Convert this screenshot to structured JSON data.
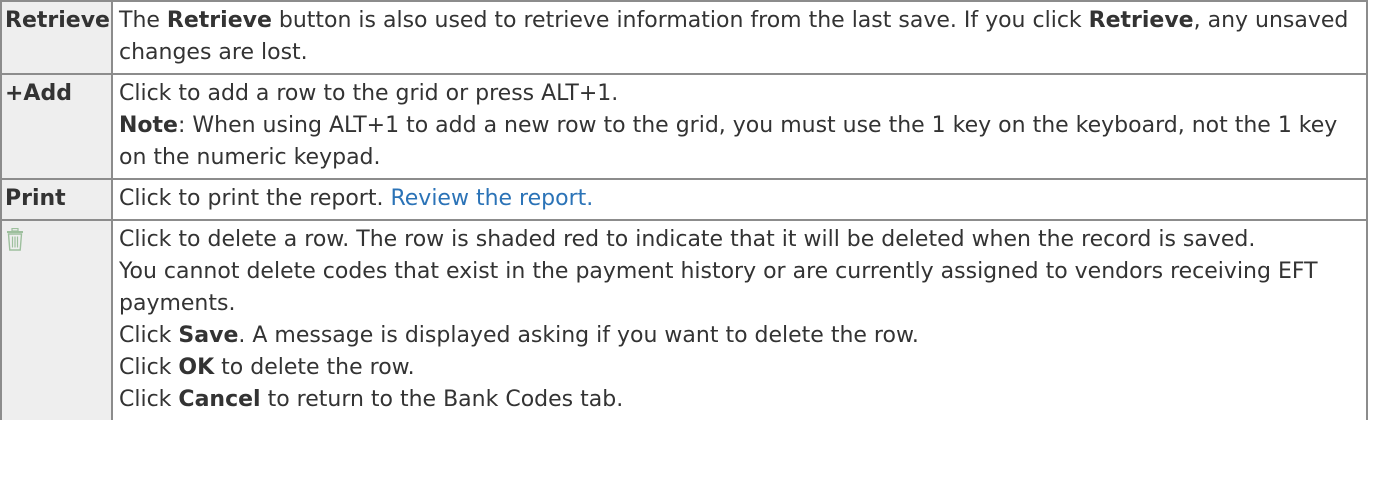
{
  "rows": [
    {
      "key": "Retrieve",
      "desc": {
        "p1": "The ",
        "b1": "Retrieve",
        "p2": " button is also used to retrieve information from the last save. If you click ",
        "b2": "Retrieve",
        "p3": ", any unsaved changes are lost."
      }
    },
    {
      "key": "+Add",
      "desc": {
        "line1": "Click to add a row to the grid or press ALT+1.",
        "note_label": "Note",
        "note_text": ": When using ALT+1 to add a new row to the grid, you must use the 1 key on the keyboard, not the 1 key on the numeric keypad."
      }
    },
    {
      "key": "Print",
      "desc": {
        "text": "Click to print the report. ",
        "link": "Review the report."
      }
    },
    {
      "key_icon": "trash-icon",
      "desc": {
        "line1": "Click to delete a row. The row is shaded red to indicate that it will be deleted when the record is saved.",
        "line2": "You cannot delete codes that exist in the payment history or are currently assigned to vendors receiving EFT payments.",
        "line3_a": "Click ",
        "line3_b": "Save",
        "line3_c": ". A message is displayed asking if you want to delete the row.",
        "line4_a": "Click ",
        "line4_b": "OK",
        "line4_c": " to delete the row.",
        "line5_a": "Click ",
        "line5_b": "Cancel",
        "line5_c": " to return to the Bank Codes tab."
      }
    }
  ],
  "colors": {
    "border": "#8c8c8c",
    "key_bg": "#eeeeee",
    "text": "#333333",
    "link": "#2b73b7",
    "icon": "#9dbf9d"
  }
}
